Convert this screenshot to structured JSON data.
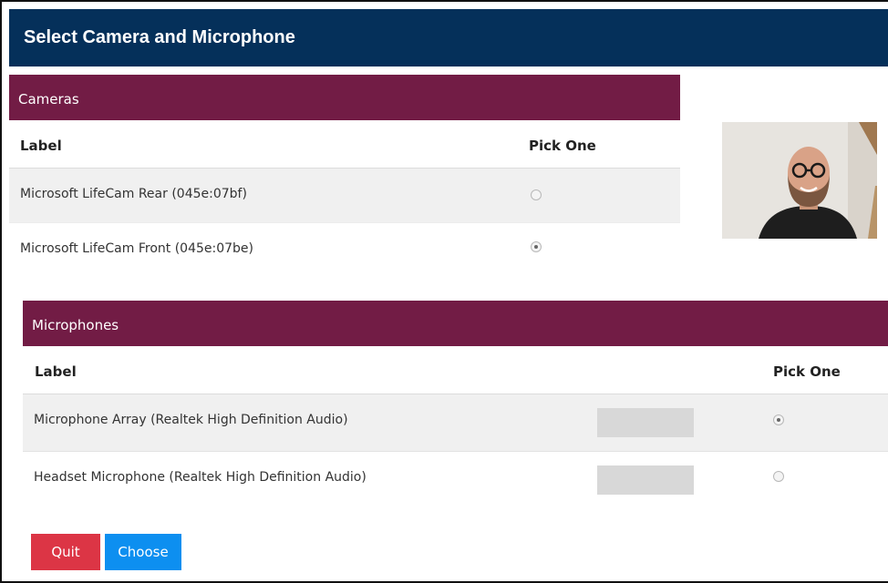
{
  "dialog": {
    "title": "Select Camera and Microphone"
  },
  "cameras": {
    "section_title": "Cameras",
    "col_label": "Label",
    "col_pick": "Pick One",
    "rows": [
      {
        "label": "Microsoft LifeCam Rear (045e:07bf)",
        "selected": false
      },
      {
        "label": "Microsoft LifeCam Front (045e:07be)",
        "selected": true
      }
    ]
  },
  "microphones": {
    "section_title": "Microphones",
    "col_label": "Label",
    "col_pick": "Pick One",
    "rows": [
      {
        "label": "Microphone Array (Realtek High Definition Audio)",
        "selected": true
      },
      {
        "label": "Headset Microphone (Realtek High Definition Audio)",
        "selected": false
      }
    ]
  },
  "buttons": {
    "quit": "Quit",
    "choose": "Choose"
  },
  "colors": {
    "title_bar": "#05305a",
    "section_header": "#721c45",
    "quit_button": "#dc3545",
    "choose_button": "#0d8ff0"
  }
}
